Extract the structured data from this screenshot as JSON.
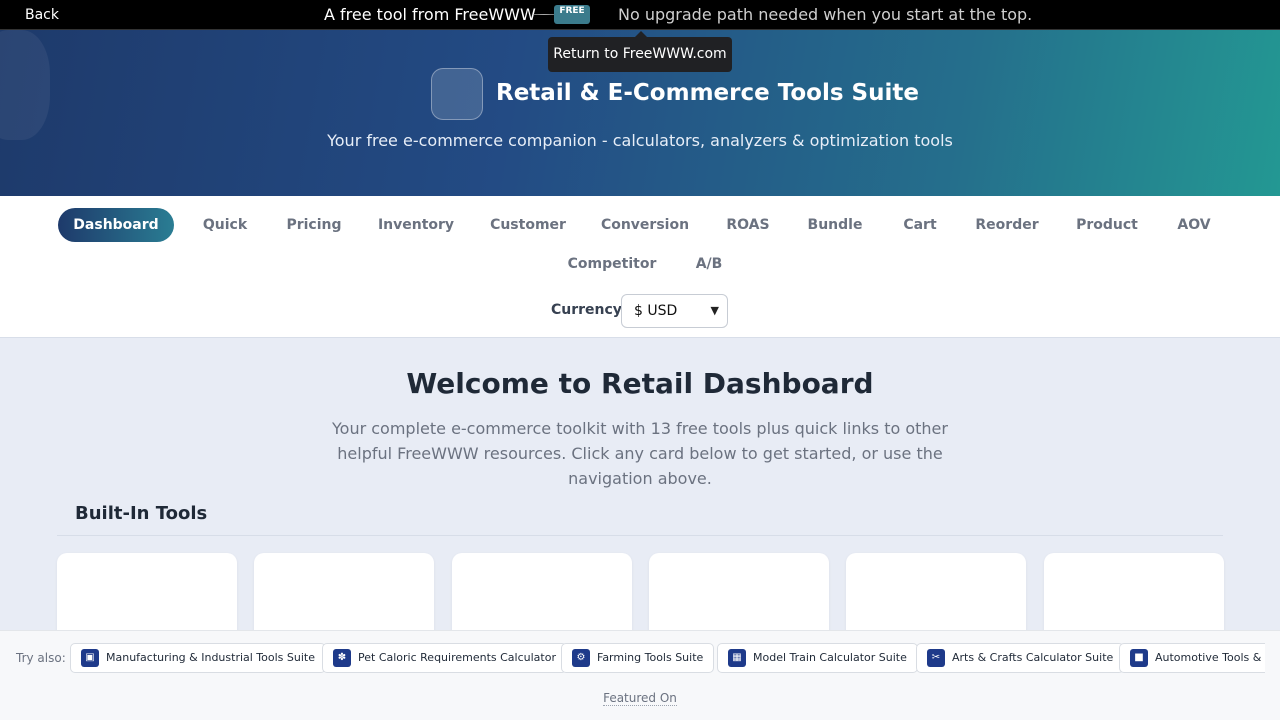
{
  "topbar": {
    "back_label": "Back",
    "promo_text": "A free tool from FreeWWW",
    "tag_label": "FREE",
    "tagline": "No upgrade path needed when you start at the top."
  },
  "tooltip": {
    "text": "Return to FreeWWW.com"
  },
  "hero": {
    "title": "Retail & E-Commerce Tools Suite",
    "subtitle": "Your free e-commerce companion - calculators, analyzers & optimization tools"
  },
  "nav": {
    "tabs": [
      "Dashboard",
      "Quick",
      "Pricing",
      "Inventory",
      "Customer",
      "Conversion",
      "ROAS",
      "Bundle",
      "Cart",
      "Reorder",
      "Product",
      "AOV",
      "Competitor",
      "A/B"
    ],
    "active_tab": "Dashboard",
    "currency_label": "Currency",
    "currency_value": "$ USD"
  },
  "main": {
    "welcome_title": "Welcome to Retail Dashboard",
    "intro_text": "Your complete e-commerce toolkit with 13 free tools plus quick links to other helpful FreeWWW resources. Click any card below to get started, or use the navigation above.",
    "section_title": "Built-In Tools"
  },
  "footer": {
    "try_label": "Try also:",
    "links": [
      {
        "label": "Manufacturing & Industrial Tools Suite",
        "icon": "factory-icon"
      },
      {
        "label": "Pet Caloric Requirements Calculator",
        "icon": "paw-icon"
      },
      {
        "label": "Farming Tools Suite",
        "icon": "tractor-icon"
      },
      {
        "label": "Model Train Calculator Suite",
        "icon": "train-icon"
      },
      {
        "label": "Arts & Crafts Calculator Suite",
        "icon": "scissors-icon"
      },
      {
        "label": "Automotive Tools & C",
        "icon": "car-icon"
      }
    ],
    "featured_label": "Featured On"
  },
  "colors": {
    "accent": "#1e3a6b",
    "accent_teal": "#2a7d93",
    "chip_icon": "#1e3a8a",
    "page_bg": "#e8ecf5"
  }
}
